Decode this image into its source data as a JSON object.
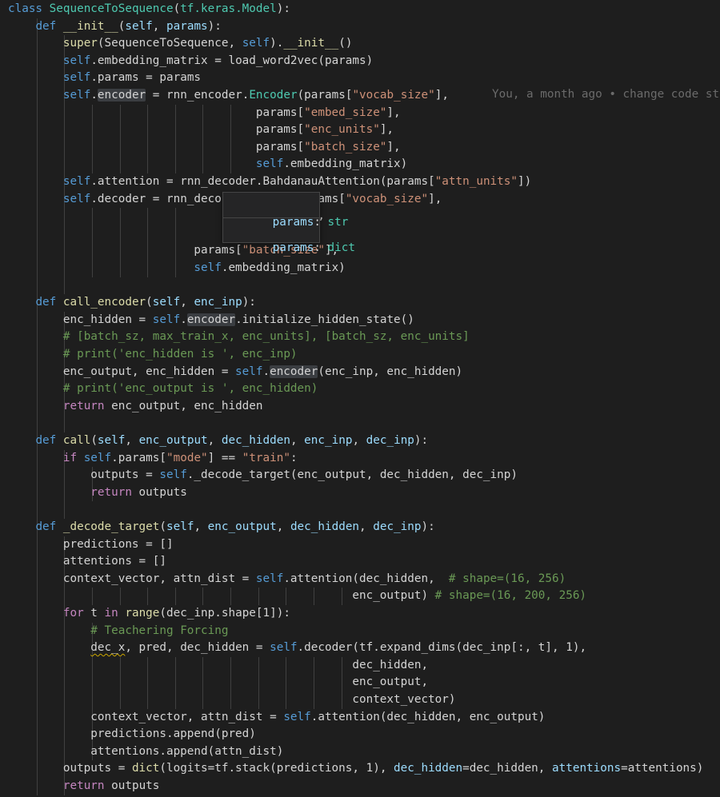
{
  "blame_annotation": "You, a month ago • change code st",
  "hover_tooltip": {
    "items": [
      {
        "name": "params",
        "colon": ": ",
        "type": "str"
      },
      {
        "name": "params",
        "colon": ": ",
        "type": "dict"
      }
    ]
  },
  "code_lines": [
    [
      [
        "kw",
        "class"
      ],
      [
        "txt",
        " "
      ],
      [
        "cls",
        "SequenceToSequence"
      ],
      [
        "txt",
        "("
      ],
      [
        "cls",
        "tf.keras.Model"
      ],
      [
        "txt",
        "):"
      ]
    ],
    [
      [
        "txt",
        "    "
      ],
      [
        "kw",
        "def"
      ],
      [
        "txt",
        " "
      ],
      [
        "fn",
        "__init__"
      ],
      [
        "txt",
        "("
      ],
      [
        "var",
        "self"
      ],
      [
        "txt",
        ", "
      ],
      [
        "var",
        "params"
      ],
      [
        "txt",
        "):"
      ]
    ],
    [
      [
        "txt",
        "        "
      ],
      [
        "fn",
        "super"
      ],
      [
        "txt",
        "("
      ],
      [
        "txt",
        "SequenceToSequence"
      ],
      [
        "txt",
        ", "
      ],
      [
        "sf",
        "self"
      ],
      [
        "txt",
        ")."
      ],
      [
        "fn",
        "__init__"
      ],
      [
        "txt",
        "()"
      ]
    ],
    [
      [
        "txt",
        "        "
      ],
      [
        "sf",
        "self"
      ],
      [
        "txt",
        ".embedding_matrix = load_word2vec(params)"
      ]
    ],
    [
      [
        "txt",
        "        "
      ],
      [
        "sf",
        "self"
      ],
      [
        "txt",
        ".params = params"
      ]
    ],
    [
      [
        "txt",
        "        "
      ],
      [
        "sf",
        "self"
      ],
      [
        "txt",
        "."
      ],
      [
        "hl",
        "encoder"
      ],
      [
        "txt",
        " = rnn_encoder."
      ],
      [
        "cls",
        "Encoder"
      ],
      [
        "txt",
        "(params["
      ],
      [
        "str",
        "\"vocab_size\""
      ],
      [
        "txt",
        "],"
      ]
    ],
    [
      [
        "txt",
        "                                    params["
      ],
      [
        "str",
        "\"embed_size\""
      ],
      [
        "txt",
        "],"
      ]
    ],
    [
      [
        "txt",
        "                                    params["
      ],
      [
        "str",
        "\"enc_units\""
      ],
      [
        "txt",
        "],"
      ]
    ],
    [
      [
        "txt",
        "                                    params["
      ],
      [
        "str",
        "\"batch_size\""
      ],
      [
        "txt",
        "],"
      ]
    ],
    [
      [
        "txt",
        "                                    "
      ],
      [
        "sf",
        "self"
      ],
      [
        "txt",
        ".embedding_matrix)"
      ]
    ],
    [
      [
        "txt",
        "        "
      ],
      [
        "sf",
        "self"
      ],
      [
        "txt",
        ".attention = rnn_decoder.BahdanauAttention(params["
      ],
      [
        "str",
        "\"attn_units\""
      ],
      [
        "txt",
        "])"
      ]
    ],
    [
      [
        "txt",
        "        "
      ],
      [
        "sf",
        "self"
      ],
      [
        "txt",
        ".decoder = rnn_deco"
      ],
      [
        "txt",
        "             "
      ],
      [
        "txt",
        "rams["
      ],
      [
        "str",
        "\"vocab_size\""
      ],
      [
        "txt",
        "],"
      ]
    ],
    [
      [
        "txt",
        "                                       "
      ],
      [
        "str",
        "size\""
      ],
      [
        "txt",
        "],"
      ]
    ],
    [
      [
        "txt",
        "                                       "
      ],
      [
        "str",
        "its\""
      ],
      [
        "txt",
        "],"
      ]
    ],
    [
      [
        "txt",
        "                           params["
      ],
      [
        "str",
        "\"batch_size\""
      ],
      [
        "txt",
        "],"
      ]
    ],
    [
      [
        "txt",
        "                           "
      ],
      [
        "sf",
        "self"
      ],
      [
        "txt",
        ".embedding_matrix)"
      ]
    ],
    [
      [
        "txt",
        ""
      ]
    ],
    [
      [
        "txt",
        "    "
      ],
      [
        "kw",
        "def"
      ],
      [
        "txt",
        " "
      ],
      [
        "fn",
        "call_encoder"
      ],
      [
        "txt",
        "("
      ],
      [
        "var",
        "self"
      ],
      [
        "txt",
        ", "
      ],
      [
        "var",
        "enc_inp"
      ],
      [
        "txt",
        "):"
      ]
    ],
    [
      [
        "txt",
        "        enc_hidden = "
      ],
      [
        "sf",
        "self"
      ],
      [
        "txt",
        "."
      ],
      [
        "hl",
        "encoder"
      ],
      [
        "txt",
        ".initialize_hidden_state()"
      ]
    ],
    [
      [
        "txt",
        "        "
      ],
      [
        "com",
        "# [batch_sz, max_train_x, enc_units], [batch_sz, enc_units]"
      ]
    ],
    [
      [
        "txt",
        "        "
      ],
      [
        "com",
        "# print('enc_hidden is ', enc_inp)"
      ]
    ],
    [
      [
        "txt",
        "        enc_output, enc_hidden = "
      ],
      [
        "sf",
        "self"
      ],
      [
        "txt",
        "."
      ],
      [
        "hl",
        "encoder"
      ],
      [
        "txt",
        "(enc_inp, enc_hidden)"
      ]
    ],
    [
      [
        "txt",
        "        "
      ],
      [
        "com",
        "# print('enc_output is ', enc_hidden)"
      ]
    ],
    [
      [
        "txt",
        "        "
      ],
      [
        "ctl",
        "return"
      ],
      [
        "txt",
        " enc_output, enc_hidden"
      ]
    ],
    [
      [
        "txt",
        ""
      ]
    ],
    [
      [
        "txt",
        "    "
      ],
      [
        "kw",
        "def"
      ],
      [
        "txt",
        " "
      ],
      [
        "fn",
        "call"
      ],
      [
        "txt",
        "("
      ],
      [
        "var",
        "self"
      ],
      [
        "txt",
        ", "
      ],
      [
        "var",
        "enc_output"
      ],
      [
        "txt",
        ", "
      ],
      [
        "var",
        "dec_hidden"
      ],
      [
        "txt",
        ", "
      ],
      [
        "var",
        "enc_inp"
      ],
      [
        "txt",
        ", "
      ],
      [
        "var",
        "dec_inp"
      ],
      [
        "txt",
        "):"
      ]
    ],
    [
      [
        "txt",
        "        "
      ],
      [
        "ctl",
        "if"
      ],
      [
        "txt",
        " "
      ],
      [
        "sf",
        "self"
      ],
      [
        "txt",
        ".params["
      ],
      [
        "str",
        "\"mode\""
      ],
      [
        "txt",
        "] == "
      ],
      [
        "str",
        "\"train\""
      ],
      [
        "txt",
        ":"
      ]
    ],
    [
      [
        "txt",
        "            outputs = "
      ],
      [
        "sf",
        "self"
      ],
      [
        "txt",
        "._decode_target(enc_output, dec_hidden, dec_inp)"
      ]
    ],
    [
      [
        "txt",
        "            "
      ],
      [
        "ctl",
        "return"
      ],
      [
        "txt",
        " outputs"
      ]
    ],
    [
      [
        "txt",
        ""
      ]
    ],
    [
      [
        "txt",
        "    "
      ],
      [
        "kw",
        "def"
      ],
      [
        "txt",
        " "
      ],
      [
        "fn",
        "_decode_target"
      ],
      [
        "txt",
        "("
      ],
      [
        "var",
        "self"
      ],
      [
        "txt",
        ", "
      ],
      [
        "var",
        "enc_output"
      ],
      [
        "txt",
        ", "
      ],
      [
        "var",
        "dec_hidden"
      ],
      [
        "txt",
        ", "
      ],
      [
        "var",
        "dec_inp"
      ],
      [
        "txt",
        "):"
      ]
    ],
    [
      [
        "txt",
        "        predictions = []"
      ]
    ],
    [
      [
        "txt",
        "        attentions = []"
      ]
    ],
    [
      [
        "txt",
        "        context_vector, attn_dist = "
      ],
      [
        "sf",
        "self"
      ],
      [
        "txt",
        ".attention(dec_hidden,  "
      ],
      [
        "com",
        "# shape=(16, 256)"
      ]
    ],
    [
      [
        "txt",
        "                                                  enc_output) "
      ],
      [
        "com",
        "# shape=(16, 200, 256)"
      ]
    ],
    [
      [
        "txt",
        "        "
      ],
      [
        "ctl",
        "for"
      ],
      [
        "txt",
        " t "
      ],
      [
        "ctl",
        "in"
      ],
      [
        "txt",
        " "
      ],
      [
        "fn",
        "range"
      ],
      [
        "txt",
        "(dec_inp.shape[1]):"
      ]
    ],
    [
      [
        "txt",
        "            "
      ],
      [
        "com",
        "# Teachering Forcing"
      ]
    ],
    [
      [
        "txt",
        "            "
      ],
      [
        "squig",
        "dec_x"
      ],
      [
        "txt",
        ", pred, dec_hidden = "
      ],
      [
        "sf",
        "self"
      ],
      [
        "txt",
        ".decoder(tf.expand_dims(dec_inp[:, t], 1),"
      ]
    ],
    [
      [
        "txt",
        "                                                  dec_hidden,"
      ]
    ],
    [
      [
        "txt",
        "                                                  enc_output,"
      ]
    ],
    [
      [
        "txt",
        "                                                  context_vector)"
      ]
    ],
    [
      [
        "txt",
        "            context_vector, attn_dist = "
      ],
      [
        "sf",
        "self"
      ],
      [
        "txt",
        ".attention(dec_hidden, enc_output)"
      ]
    ],
    [
      [
        "txt",
        "            predictions.append(pred)"
      ]
    ],
    [
      [
        "txt",
        "            attentions.append(attn_dist)"
      ]
    ],
    [
      [
        "txt",
        "        outputs = "
      ],
      [
        "fn",
        "dict"
      ],
      [
        "txt",
        "(logits=tf.stack(predictions, 1), "
      ],
      [
        "var",
        "dec_hidden"
      ],
      [
        "txt",
        "=dec_hidden, "
      ],
      [
        "var",
        "attentions"
      ],
      [
        "txt",
        "=attentions)"
      ]
    ],
    [
      [
        "txt",
        "        "
      ],
      [
        "ctl",
        "return"
      ],
      [
        "txt",
        " outputs"
      ]
    ]
  ]
}
